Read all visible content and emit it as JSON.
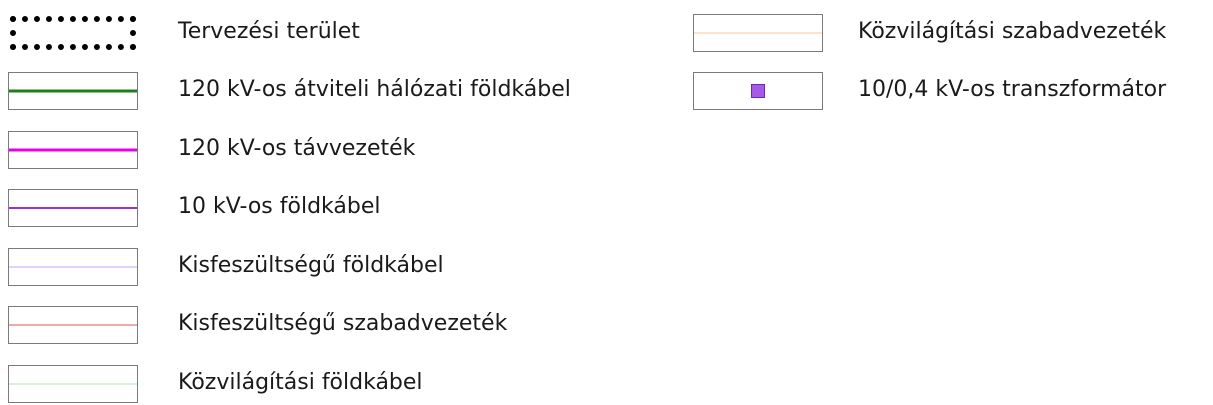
{
  "legend": {
    "left_column": [
      {
        "label": "Tervezési terület",
        "symbol": "dotted-box",
        "color": "#000000"
      },
      {
        "label": "120 kV-os átviteli hálózati földkábel",
        "symbol": "line",
        "color": "#1e7d1e",
        "weight": "thick"
      },
      {
        "label": "120 kV-os távvezeték",
        "symbol": "line",
        "color": "#e600e6",
        "weight": "thick"
      },
      {
        "label": "10 kV-os földkábel",
        "symbol": "line",
        "color": "#9b30d9",
        "weight": "medium"
      },
      {
        "label": "Kisfeszültségű földkábel",
        "symbol": "line",
        "color": "#c9a3f0",
        "weight": "thin"
      },
      {
        "label": "Kisfeszültségű szabadvezeték",
        "symbol": "line",
        "color": "#e05050",
        "weight": "thin"
      },
      {
        "label": "Közvilágítási földkábel",
        "symbol": "line",
        "color": "#a7e8a7",
        "weight": "thin"
      }
    ],
    "right_column": [
      {
        "label": "Közvilágítási szabadvezeték",
        "symbol": "line",
        "color": "#f5c89a",
        "weight": "thin"
      },
      {
        "label": "10/0,4 kV-os transzformátor",
        "symbol": "square",
        "color": "#a85ae6"
      }
    ]
  }
}
